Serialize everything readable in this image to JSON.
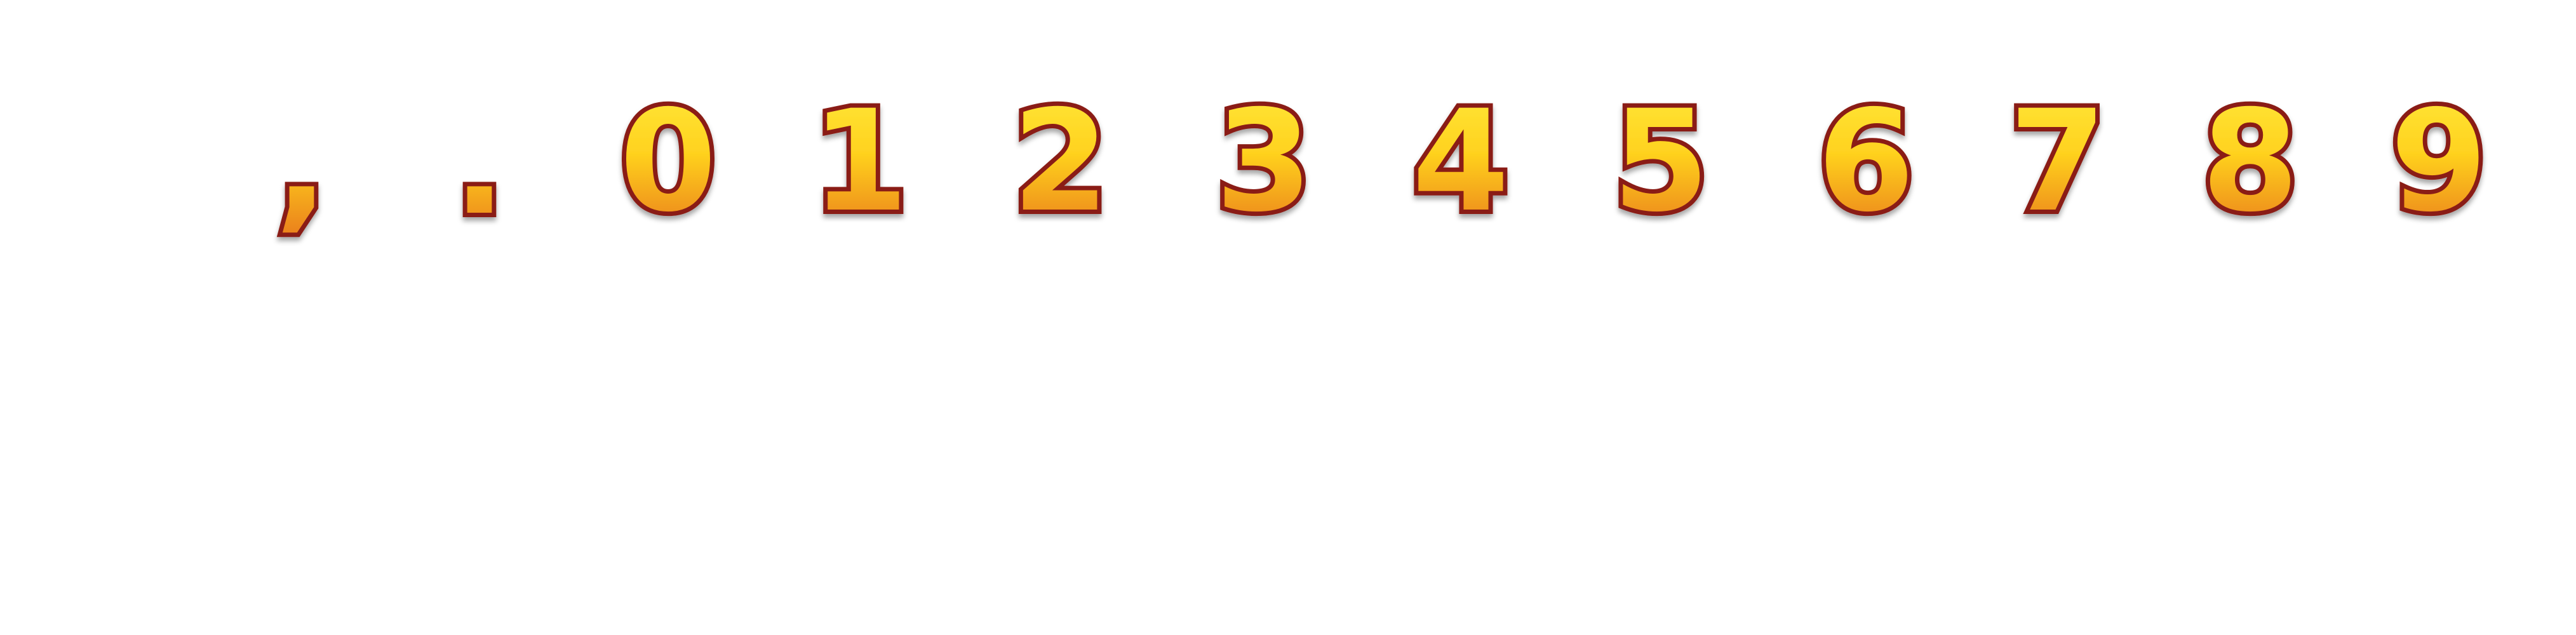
{
  "sprite_sheet": {
    "glyphs": [
      {
        "char": ","
      },
      {
        "char": "."
      },
      {
        "char": "0"
      },
      {
        "char": "1"
      },
      {
        "char": "2"
      },
      {
        "char": "3"
      },
      {
        "char": "4"
      },
      {
        "char": "5"
      },
      {
        "char": "6"
      },
      {
        "char": "7"
      },
      {
        "char": "8"
      },
      {
        "char": "9"
      }
    ],
    "colors": {
      "fill_top": "#ffe93a",
      "fill_bottom": "#e8751a",
      "outline_outer": "#8a1a12",
      "outline_mid": "#d3331b",
      "shadow": "#00000055"
    }
  }
}
